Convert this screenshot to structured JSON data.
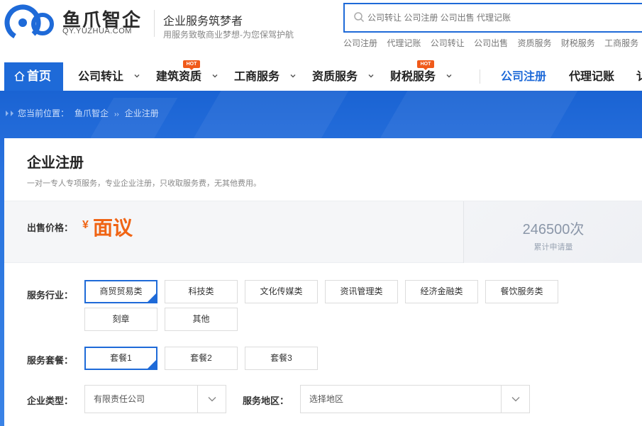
{
  "brand": {
    "name": "鱼爪智企",
    "domain": "QY.YUZHUA.COM",
    "slogan": "企业服务筑梦者",
    "slogan_sub": "用服务致敬商业梦想-为您保驾护航",
    "accent_color": "#1e6ad8"
  },
  "search": {
    "placeholder": "公司转让 公司注册 公司出售 代理记账",
    "hot_links": [
      "公司注册",
      "代理记账",
      "公司转让",
      "公司出售",
      "资质服务",
      "财税服务",
      "工商服务"
    ]
  },
  "nav": {
    "home": "首页",
    "items": [
      {
        "label": "公司转让",
        "hot": false
      },
      {
        "label": "建筑资质",
        "hot": true
      },
      {
        "label": "工商服务",
        "hot": false
      },
      {
        "label": "资质服务",
        "hot": false
      },
      {
        "label": "财税服务",
        "hot": true
      }
    ],
    "hot_badge": "HOT",
    "right_items": [
      "公司注册",
      "代理记账",
      "讠"
    ]
  },
  "breadcrumb": {
    "prefix": "您当前位置：",
    "items": [
      "鱼爪智企",
      "企业注册"
    ],
    "separator": "››"
  },
  "service": {
    "title": "企业注册",
    "subtitle": "一对一专人专项服务，专业企业注册，只收取服务费，无其他费用。",
    "price_label": "出售价格：",
    "price_currency": "¥",
    "price_value": "面议",
    "apply_count": "246500次",
    "apply_label": "累计申请量",
    "price_color": "#f06414"
  },
  "form": {
    "industry_label": "服务行业：",
    "industries": [
      "商贸贸易类",
      "科技类",
      "文化传媒类",
      "资讯管理类",
      "经济金融类",
      "餐饮服务类",
      "刻章",
      "其他"
    ],
    "industry_selected": "商贸贸易类",
    "package_label": "服务套餐：",
    "packages": [
      "套餐1",
      "套餐2",
      "套餐3"
    ],
    "package_selected": "套餐1",
    "company_type_label": "企业类型：",
    "company_type_value": "有限责任公司",
    "region_label": "服务地区：",
    "region_value": "选择地区"
  }
}
